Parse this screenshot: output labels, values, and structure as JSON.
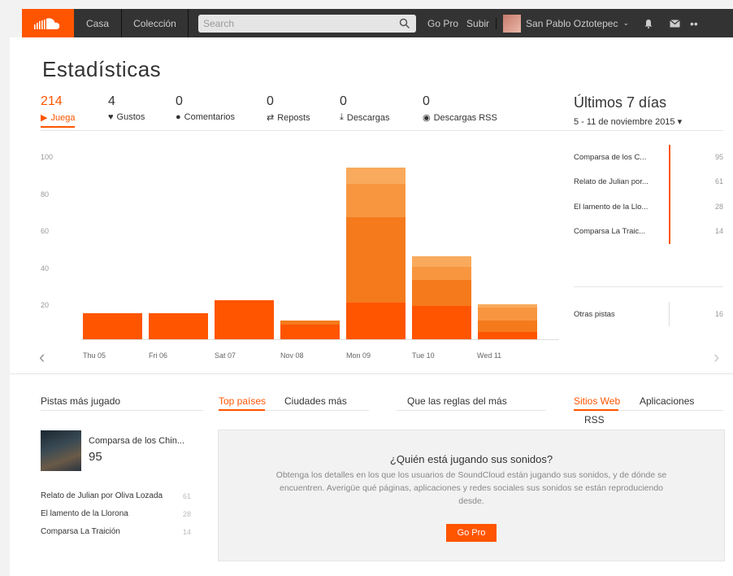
{
  "nav": {
    "home": "Casa",
    "collection": "Colección",
    "search_placeholder": "Search",
    "gopro": "Go Pro",
    "upload": "Subir",
    "username": "San Pablo Oztotepec"
  },
  "page_title": "Estadísticas",
  "stats": [
    {
      "value": "214",
      "label": "Juega"
    },
    {
      "value": "4",
      "label": "Gustos"
    },
    {
      "value": "0",
      "label": "Comentarios"
    },
    {
      "value": "0",
      "label": "Reposts"
    },
    {
      "value": "0",
      "label": "Descargas"
    },
    {
      "value": "0",
      "label": "Descargas RSS"
    }
  ],
  "range": {
    "title": "Últimos 7 días",
    "dates": "5 - 11 de noviembre 2015"
  },
  "chart_data": {
    "type": "bar",
    "categories": [
      "Thu 05",
      "Fri 06",
      "Sat 07",
      "Nov 08",
      "Mon 09",
      "Tue 10",
      "Wed 11"
    ],
    "yticks": [
      "100",
      "80",
      "60",
      "40",
      "20"
    ],
    "ylim": [
      0,
      100
    ],
    "series": [
      {
        "values": [
          14,
          14,
          21,
          8,
          20,
          18,
          4
        ]
      },
      {
        "values": [
          0,
          0,
          0,
          2,
          46,
          14,
          6
        ]
      },
      {
        "values": [
          0,
          0,
          0,
          0,
          18,
          7,
          7
        ]
      },
      {
        "values": [
          0,
          0,
          0,
          0,
          9,
          6,
          2
        ]
      }
    ],
    "colors": [
      "#ff5500",
      "#f57a1c",
      "#f89640",
      "#f9aa5c"
    ]
  },
  "tracks": [
    {
      "name": "Comparsa de los C...",
      "plays": "95"
    },
    {
      "name": "Relato de Julian por...",
      "plays": "61"
    },
    {
      "name": "El lamento de la Llo...",
      "plays": "28"
    },
    {
      "name": "Comparsa La Traic...",
      "plays": "14"
    }
  ],
  "other_tracks": {
    "name": "Otras pistas",
    "plays": "16"
  },
  "top_tracks": {
    "title": "Pistas más jugado",
    "featured": {
      "name": "Comparsa de los Chin...",
      "plays": "95"
    },
    "list": [
      {
        "name": "Relato de Julian por Oliva Lozada",
        "plays": "61"
      },
      {
        "name": "El lamento de la Llorona",
        "plays": "28"
      },
      {
        "name": "Comparsa La Traición",
        "plays": "14"
      }
    ]
  },
  "tabs": {
    "countries": "Top países",
    "cities": "Ciudades más",
    "rules": "Que las reglas del más",
    "websites": "Sitios Web",
    "apps": "Aplicaciones",
    "rss": "RSS"
  },
  "promo": {
    "heading": "¿Quién está jugando sus sonidos?",
    "body": "Obtenga los detalles en los que los usuarios de SoundCloud están jugando sus sonidos, y de dónde se encuentren. Averigüe qué páginas, aplicaciones y redes sociales sus sonidos se están reproduciendo desde.",
    "button": "Go Pro"
  }
}
